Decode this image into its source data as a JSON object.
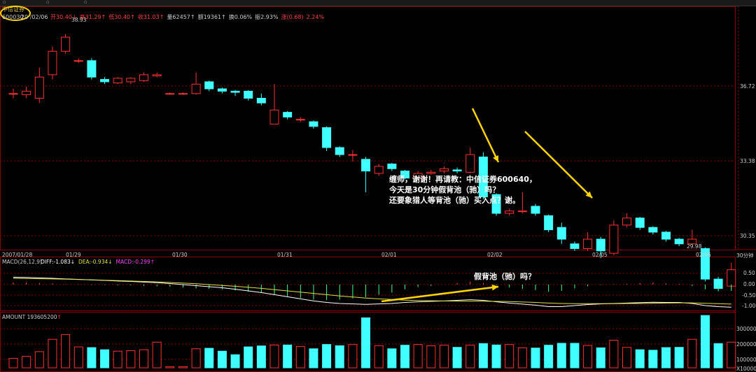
{
  "header": {
    "title": "中信证券",
    "code": "600030",
    "date": "20 /02/06",
    "quote": [
      {
        "label": "开",
        "value": "30.40",
        "arrow": "↓",
        "color": "#ff4040"
      },
      {
        "label": "高",
        "value": "31.29",
        "arrow": "↑",
        "color": "#ff4040"
      },
      {
        "label": "低",
        "value": "30.40",
        "arrow": "↑",
        "color": "#ff4040"
      },
      {
        "label": "收",
        "value": "31.03",
        "arrow": "↑",
        "color": "#ff4040"
      },
      {
        "label": "量",
        "value": "62457",
        "arrow": "↑",
        "color": "#cccccc"
      },
      {
        "label": "额",
        "value": "19361",
        "arrow": "↑",
        "color": "#cccccc"
      },
      {
        "label": "换",
        "value": "0.06%",
        "arrow": "",
        "color": "#cccccc"
      },
      {
        "label": "振",
        "value": "2.93%",
        "arrow": "",
        "color": "#cccccc"
      },
      {
        "label": "涨",
        "value": "(0.68)",
        "arrow": "",
        "color": "#ff4040"
      },
      {
        "label": "",
        "value": "2.24%",
        "arrow": "",
        "color": "#ff4040"
      }
    ]
  },
  "price_axis": [
    "36.72",
    "33.38",
    "30.35"
  ],
  "price_marks": {
    "high": "38.93",
    "low": "29.98"
  },
  "time_axis": [
    "2007/01/28",
    "01/29",
    "01/30",
    "01/31",
    "02/01",
    "02/02",
    "02/05",
    "02/06"
  ],
  "period": "30分钟",
  "annotation_main": {
    "line1": "缠师，谢谢！再请教：中信证券600640，",
    "line2": "今天是30分钟假背池（驰）吗？",
    "line3": "还要象猎人等背池（驰）买入点？谢。"
  },
  "annotation_macd": "假背池（驰）吗？",
  "macd_panel": {
    "label": "MACD(26,12,9)",
    "items": [
      {
        "text": "DIFF:-1.083",
        "arrow": "↓",
        "color": "#ffffff"
      },
      {
        "text": "DEA:-0.934",
        "arrow": "↓",
        "color": "#e0e040"
      },
      {
        "text": "MACD:-0.299",
        "arrow": "↑",
        "color": "#ff40ff"
      }
    ],
    "axis": [
      "0.50",
      "0.00",
      "-0.50",
      "-1.00"
    ]
  },
  "amount_panel": {
    "label": "AMOUNT 193605200",
    "arrow": "↑",
    "axis": [
      "300000",
      "200000",
      "100000",
      "X10000"
    ]
  },
  "colors": {
    "up": "#ff3030",
    "down": "#40ffff",
    "grid": "#8b0000",
    "annotation": "#ffd400"
  },
  "chart_data": {
    "type": "candlestick",
    "candles": [
      {
        "o": 36.4,
        "c": 36.4,
        "h": 36.6,
        "l": 36.2
      },
      {
        "o": 36.35,
        "c": 36.5,
        "h": 36.7,
        "l": 36.2
      },
      {
        "o": 36.2,
        "c": 37.1,
        "h": 37.5,
        "l": 36.0
      },
      {
        "o": 37.2,
        "c": 38.2,
        "h": 38.4,
        "l": 37.0
      },
      {
        "o": 38.2,
        "c": 38.8,
        "h": 38.93,
        "l": 38.1
      },
      {
        "o": 37.8,
        "c": 37.8,
        "h": 37.9,
        "l": 37.7
      },
      {
        "o": 37.8,
        "c": 37.1,
        "h": 37.9,
        "l": 37.0
      },
      {
        "o": 37.0,
        "c": 36.9,
        "h": 37.1,
        "l": 36.8
      },
      {
        "o": 36.85,
        "c": 37.05,
        "h": 37.1,
        "l": 36.8
      },
      {
        "o": 36.9,
        "c": 37.05,
        "h": 37.1,
        "l": 36.8
      },
      {
        "o": 36.95,
        "c": 37.2,
        "h": 37.3,
        "l": 36.9
      },
      {
        "o": 37.15,
        "c": 37.2,
        "h": 37.3,
        "l": 37.1
      },
      {
        "o": 36.4,
        "c": 36.4,
        "h": 36.45,
        "l": 36.35
      },
      {
        "o": 36.4,
        "c": 36.4,
        "h": 36.45,
        "l": 36.35
      },
      {
        "o": 36.4,
        "c": 36.8,
        "h": 37.3,
        "l": 36.35
      },
      {
        "o": 36.9,
        "c": 36.6,
        "h": 36.95,
        "l": 36.5
      },
      {
        "o": 36.6,
        "c": 36.5,
        "h": 36.65,
        "l": 36.4
      },
      {
        "o": 36.5,
        "c": 36.45,
        "h": 36.55,
        "l": 36.3
      },
      {
        "o": 36.5,
        "c": 36.2,
        "h": 36.55,
        "l": 36.1
      },
      {
        "o": 36.2,
        "c": 36.0,
        "h": 36.4,
        "l": 35.9
      },
      {
        "o": 35.1,
        "c": 35.7,
        "h": 36.8,
        "l": 35.1
      },
      {
        "o": 35.6,
        "c": 35.4,
        "h": 35.65,
        "l": 35.3
      },
      {
        "o": 35.3,
        "c": 35.3,
        "h": 35.4,
        "l": 35.2
      },
      {
        "o": 35.2,
        "c": 35.0,
        "h": 35.25,
        "l": 34.9
      },
      {
        "o": 34.95,
        "c": 34.1,
        "h": 35.0,
        "l": 33.95
      },
      {
        "o": 34.1,
        "c": 33.8,
        "h": 34.15,
        "l": 33.7
      },
      {
        "o": 33.8,
        "c": 33.8,
        "h": 34.0,
        "l": 33.5
      },
      {
        "o": 33.6,
        "c": 33.1,
        "h": 33.7,
        "l": 32.2
      },
      {
        "o": 33.0,
        "c": 33.3,
        "h": 33.4,
        "l": 32.9
      },
      {
        "o": 33.4,
        "c": 33.2,
        "h": 33.45,
        "l": 33.1
      },
      {
        "o": 33.1,
        "c": 32.8,
        "h": 33.15,
        "l": 32.75
      },
      {
        "o": 32.8,
        "c": 33.0,
        "h": 33.1,
        "l": 32.75
      },
      {
        "o": 33.0,
        "c": 33.05,
        "h": 33.15,
        "l": 32.95
      },
      {
        "o": 33.1,
        "c": 33.2,
        "h": 33.3,
        "l": 33.0
      },
      {
        "o": 33.15,
        "c": 33.1,
        "h": 33.25,
        "l": 33.0
      },
      {
        "o": 33.05,
        "c": 33.8,
        "h": 34.1,
        "l": 33.0
      },
      {
        "o": 33.7,
        "c": 32.0,
        "h": 33.9,
        "l": 31.9
      },
      {
        "o": 32.1,
        "c": 31.3,
        "h": 32.15,
        "l": 31.2
      },
      {
        "o": 31.3,
        "c": 31.4,
        "h": 31.5,
        "l": 31.2
      },
      {
        "o": 31.4,
        "c": 31.4,
        "h": 32.2,
        "l": 31.3
      },
      {
        "o": 31.6,
        "c": 31.3,
        "h": 31.7,
        "l": 31.2
      },
      {
        "o": 31.2,
        "c": 30.6,
        "h": 31.25,
        "l": 30.5
      },
      {
        "o": 30.7,
        "c": 30.2,
        "h": 30.9,
        "l": 30.0
      },
      {
        "o": 30.0,
        "c": 29.8,
        "h": 30.1,
        "l": 29.7
      },
      {
        "o": 29.8,
        "c": 30.2,
        "h": 30.5,
        "l": 29.7
      },
      {
        "o": 30.2,
        "c": 29.7,
        "h": 30.3,
        "l": 29.4
      },
      {
        "o": 29.6,
        "c": 30.8,
        "h": 31.0,
        "l": 29.5
      },
      {
        "o": 30.8,
        "c": 31.1,
        "h": 31.3,
        "l": 30.7
      },
      {
        "o": 31.1,
        "c": 30.7,
        "h": 31.15,
        "l": 30.6
      },
      {
        "o": 30.7,
        "c": 30.5,
        "h": 30.75,
        "l": 30.4
      },
      {
        "o": 30.5,
        "c": 30.2,
        "h": 30.55,
        "l": 30.1
      },
      {
        "o": 30.2,
        "c": 30.0,
        "h": 30.25,
        "l": 29.9
      },
      {
        "o": 30.0,
        "c": 30.2,
        "h": 30.6,
        "l": 29.95
      },
      {
        "o": 29.8,
        "c": 28.5,
        "h": 29.85,
        "l": 28.4
      },
      {
        "o": 28.5,
        "c": 28.1,
        "h": 28.6,
        "l": 27.98
      },
      {
        "o": 28.2,
        "c": 28.9,
        "h": 29.2,
        "l": 28.1
      }
    ],
    "amount": [
      40,
      48,
      68,
      120,
      140,
      88,
      85,
      76,
      70,
      72,
      76,
      108,
      5,
      5,
      80,
      82,
      70,
      55,
      88,
      92,
      96,
      96,
      90,
      80,
      98,
      93,
      98,
      210,
      93,
      80,
      95,
      98,
      93,
      95,
      86,
      95,
      102,
      96,
      98,
      84,
      83,
      95,
      103,
      103,
      94,
      84,
      116,
      86,
      76,
      74,
      85,
      86,
      120,
      220,
      102,
      108
    ],
    "diff": [
      0.35,
      0.34,
      0.32,
      0.3,
      0.27,
      0.25,
      0.22,
      0.2,
      0.17,
      0.15,
      0.12,
      0.09,
      0.05,
      0.0,
      -0.05,
      -0.1,
      -0.15,
      -0.22,
      -0.3,
      -0.38,
      -0.48,
      -0.58,
      -0.68,
      -0.78,
      -0.85,
      -0.9,
      -0.92,
      -0.94,
      -0.92,
      -0.9,
      -0.85,
      -0.82,
      -0.8,
      -0.78,
      -0.75,
      -0.72,
      -0.75,
      -0.82,
      -0.88,
      -0.93,
      -0.98,
      -1.05,
      -1.05,
      -1.0,
      -0.95,
      -0.92,
      -0.9,
      -0.88,
      -0.86,
      -0.84,
      -0.85,
      -0.85,
      -0.9,
      -1.0,
      -1.05,
      -1.08
    ],
    "dea": [
      0.3,
      0.29,
      0.28,
      0.27,
      0.26,
      0.24,
      0.23,
      0.21,
      0.19,
      0.17,
      0.15,
      0.13,
      0.1,
      0.07,
      0.04,
      0.0,
      -0.04,
      -0.08,
      -0.13,
      -0.18,
      -0.24,
      -0.3,
      -0.36,
      -0.42,
      -0.48,
      -0.54,
      -0.59,
      -0.64,
      -0.68,
      -0.71,
      -0.74,
      -0.76,
      -0.77,
      -0.78,
      -0.79,
      -0.79,
      -0.79,
      -0.8,
      -0.81,
      -0.83,
      -0.85,
      -0.88,
      -0.9,
      -0.91,
      -0.91,
      -0.91,
      -0.91,
      -0.9,
      -0.9,
      -0.89,
      -0.88,
      -0.87,
      -0.87,
      -0.89,
      -0.91,
      -0.93
    ]
  }
}
